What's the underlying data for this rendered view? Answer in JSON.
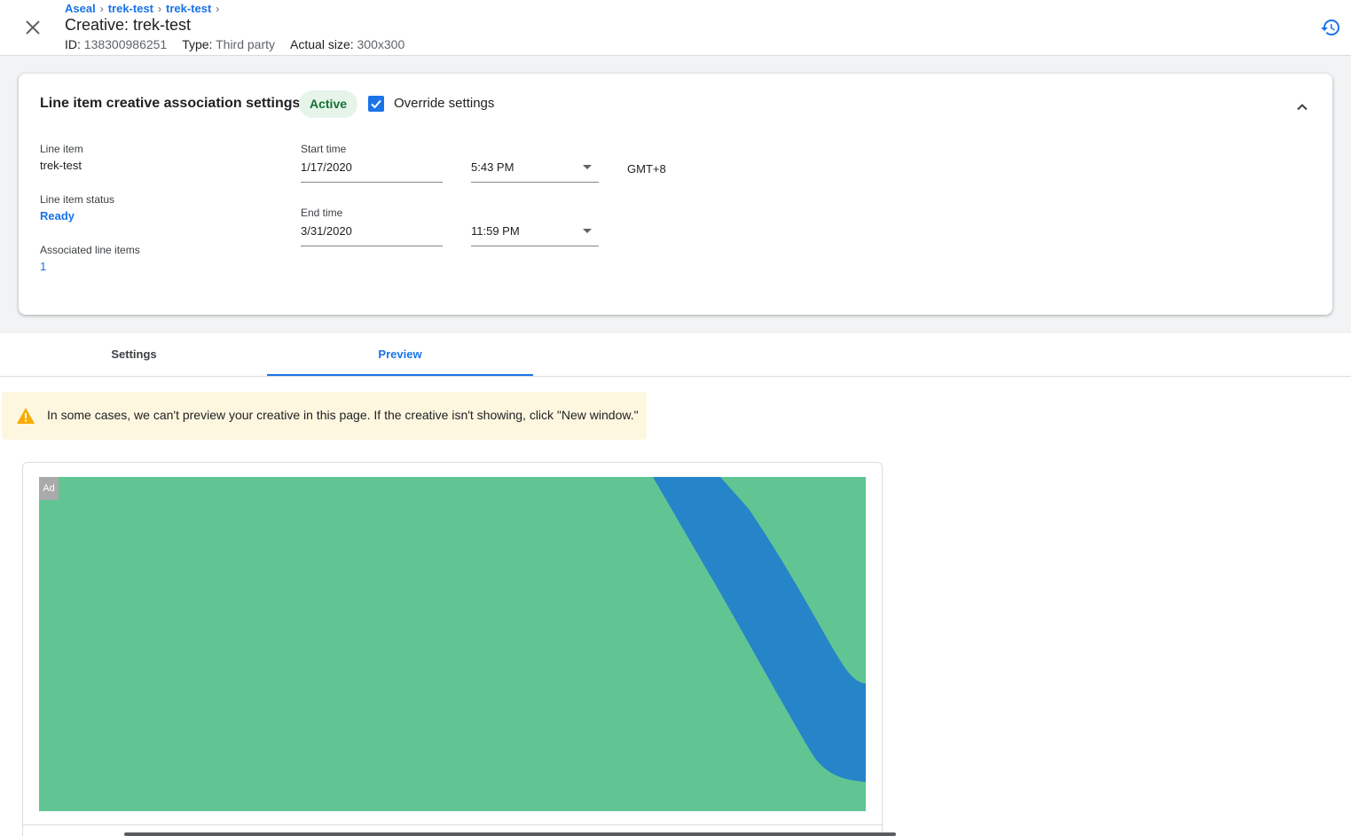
{
  "header": {
    "breadcrumb": [
      "Aseal",
      "trek-test",
      "trek-test"
    ],
    "title": "Creative: trek-test",
    "id_label": "ID:",
    "id_value": "138300986251",
    "type_label": "Type:",
    "type_value": "Third party",
    "size_label": "Actual size:",
    "size_value": "300x300"
  },
  "settings_card": {
    "title": "Line item creative association settings",
    "status_chip": "Active",
    "override_label": "Override settings",
    "override_checked": true,
    "line_item_label": "Line item",
    "line_item_value": "trek-test",
    "status_label": "Line item status",
    "status_value": "Ready",
    "associated_label": "Associated line items",
    "associated_value": "1",
    "start_label": "Start time",
    "start_date": "1/17/2020",
    "start_time": "5:43 PM",
    "timezone": "GMT+8",
    "end_label": "End time",
    "end_date": "3/31/2020",
    "end_time": "11:59 PM"
  },
  "tabs": [
    {
      "label": "Settings",
      "active": false
    },
    {
      "label": "Preview",
      "active": true
    }
  ],
  "warning": {
    "text": "In some cases, we can't preview your creative in this page. If the creative isn't showing, click \"New window.\"",
    "icon": "warning-icon"
  },
  "preview": {
    "ad_badge": "Ad",
    "colors": {
      "background": "#61c593",
      "stripe": "#2684c9"
    }
  },
  "colors": {
    "accent": "#1a73e8",
    "active_chip_bg": "#e6f4ea",
    "active_chip_text": "#137333",
    "warning_bg": "#fef7e0",
    "warning_icon": "#f9ab00"
  }
}
